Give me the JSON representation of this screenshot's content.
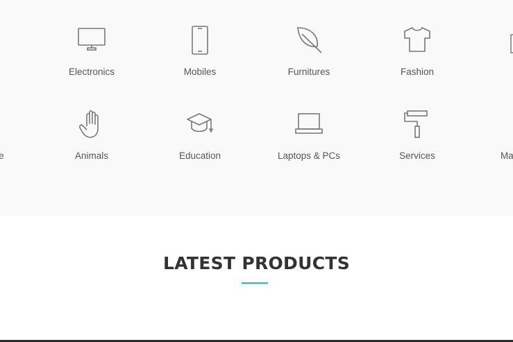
{
  "categories": {
    "row1": [
      {
        "label": "Electronics",
        "icon": "monitor-icon"
      },
      {
        "label": "Mobiles",
        "icon": "smartphone-icon"
      },
      {
        "label": "Furnitures",
        "icon": "leaf-icon"
      },
      {
        "label": "Fashion",
        "icon": "tshirt-icon"
      }
    ],
    "row2": [
      {
        "label": "te",
        "icon": ""
      },
      {
        "label": "Animals",
        "icon": "hand-icon"
      },
      {
        "label": "Education",
        "icon": "graduation-cap-icon"
      },
      {
        "label": "Laptops & PCs",
        "icon": "laptop-icon"
      },
      {
        "label": "Services",
        "icon": "paint-roller-icon"
      },
      {
        "label": "Ma",
        "icon": ""
      }
    ]
  },
  "latest": {
    "title": "LATEST PRODUCTS",
    "accent_color": "#28b6c7"
  }
}
